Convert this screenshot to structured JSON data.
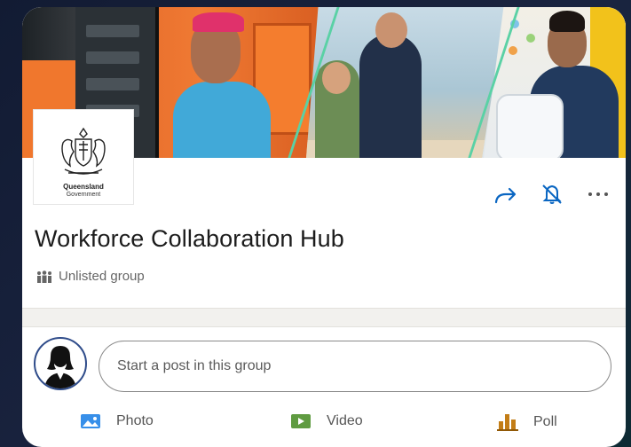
{
  "group": {
    "title": "Workforce Collaboration Hub",
    "visibility": "Unlisted group",
    "logo_line1": "Queensland",
    "logo_line2": "Government"
  },
  "actions": {
    "share_icon": "share-arrow-icon",
    "notify_icon": "bell-off-icon",
    "more_icon": "more-horizontal-icon"
  },
  "composer": {
    "placeholder": "Start a post in this group",
    "attachments": [
      {
        "label": "Photo",
        "icon": "photo-icon",
        "color": "#378fe9"
      },
      {
        "label": "Video",
        "icon": "video-icon",
        "color": "#5f9b41"
      },
      {
        "label": "Poll",
        "icon": "poll-icon",
        "color": "#c37d16"
      }
    ]
  },
  "colors": {
    "accent_blue": "#0a66c2",
    "background": "#121b33",
    "card": "#ffffff"
  }
}
